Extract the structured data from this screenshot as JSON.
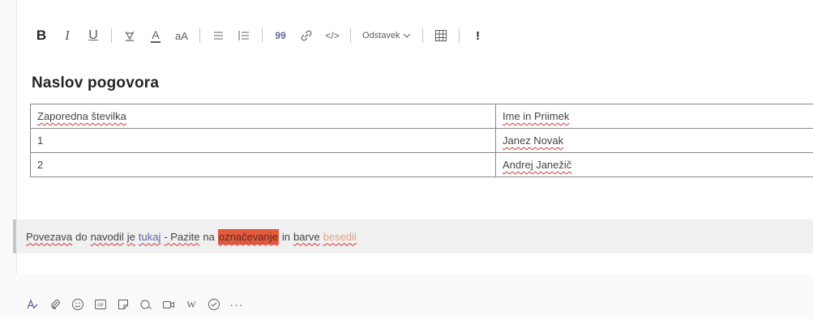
{
  "toolbar": {
    "bold": "B",
    "italic": "I",
    "underline": "U",
    "font_color": "A",
    "font_size": "aA",
    "quote": "99",
    "code": "</>",
    "paragraph_style": "Odstavek",
    "important": "!"
  },
  "message": {
    "heading": "Naslov pogovora",
    "table": {
      "headers": [
        "Zaporedna številka",
        "Ime in Priimek"
      ],
      "rows": [
        [
          "1",
          "Janez Novak"
        ],
        [
          "2",
          "Andrej Janežič"
        ]
      ]
    },
    "callout": {
      "w1": "Povezava",
      "w2": "do",
      "w3": "navodil",
      "w4": "je",
      "link": "tukaj",
      "w5": "- Pazite",
      "w6": "na",
      "highlighted": "označevanje",
      "w7": "in",
      "w8": "barve",
      "colored": "besedil"
    }
  },
  "bottombar": {
    "gif_label": "GIF",
    "w_label": "W",
    "more_label": "···"
  },
  "colors": {
    "accent": "#6264a7",
    "highlight": "#e35a3f",
    "callout_bg": "#f0f0f0"
  }
}
